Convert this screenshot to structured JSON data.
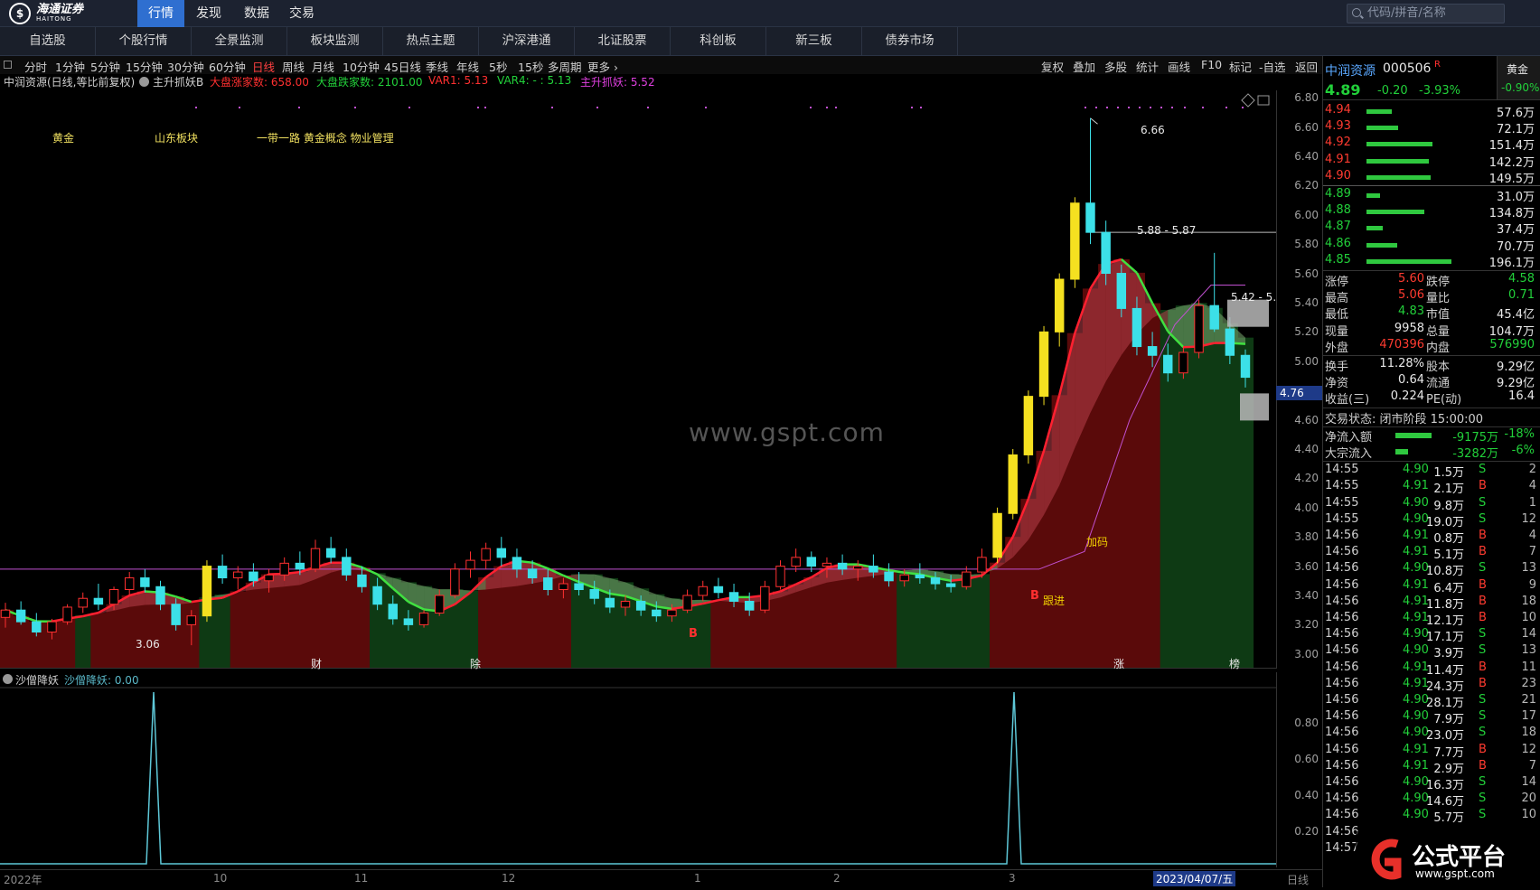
{
  "topbar": {
    "logo_text": "海通证券",
    "logo_sub": "HAITONG",
    "menus": [
      "行情",
      "发现",
      "数据",
      "交易"
    ],
    "search_placeholder": "代码/拼音/名称"
  },
  "nav": [
    "自选股",
    "个股行情",
    "全景监测",
    "板块监测",
    "热点主题",
    "沪深港通",
    "北证股票",
    "科创板",
    "新三板",
    "债券市场"
  ],
  "periods": [
    "分时",
    "1分钟",
    "5分钟",
    "15分钟",
    "30分钟",
    "60分钟",
    "日线",
    "周线",
    "月线",
    "10分钟",
    "45日线",
    "季线",
    "年线",
    "5秒",
    "15秒",
    "多周期",
    "更多 ›"
  ],
  "active_period": "日线",
  "right_tools": [
    "复权",
    "叠加",
    "多股",
    "统计",
    "画线",
    "F10",
    "标记",
    "-自选",
    "返回"
  ],
  "indicator_line": {
    "title": "中润资源(日线,等比前复权)",
    "indicator": "主升抓妖B",
    "items": [
      {
        "text": "大盘涨家数: 658.00",
        "color": "#ff3030"
      },
      {
        "text": "大盘跌家数: 2101.00",
        "color": "#22d03a"
      },
      {
        "text": "VAR1: 5.13",
        "color": "#ff3030"
      },
      {
        "text": "VAR4: - : 5.13",
        "color": "#22d03a"
      },
      {
        "text": "主升抓妖: 5.52",
        "color": "#e040e0"
      }
    ]
  },
  "tags": [
    "黄金",
    "山东板块",
    "一带一路 黄金概念 物业管理"
  ],
  "annotations": {
    "high_label": "6.66",
    "level_line": "5.88 - 5.87",
    "level_line2": "5.42 - 5.",
    "low_label": "3.06",
    "jiama": "加码",
    "genjin": "跟进",
    "B": "B",
    "event_cai": "财",
    "event_chu": "除",
    "event_zhang": "涨",
    "event_bang": "榜"
  },
  "watermark": "www.gspt.com",
  "y_axis": [
    "6.80",
    "6.60",
    "6.40",
    "6.20",
    "6.00",
    "5.80",
    "5.60",
    "5.40",
    "5.20",
    "5.00",
    "4.80",
    "4.60",
    "4.40",
    "4.20",
    "4.00",
    "3.80",
    "3.60",
    "3.40",
    "3.20",
    "3.00"
  ],
  "current_price_tag": "4.76",
  "sub_indicator": {
    "name": "沙僧降妖",
    "value_label": "沙僧降妖: 0.00"
  },
  "sub_y_axis": [
    "0.80",
    "0.60",
    "0.40",
    "0.20"
  ],
  "x_axis": [
    "2022年",
    "10",
    "11",
    "12",
    "1",
    "2",
    "3",
    "2023/04/07/五"
  ],
  "x_period": "日线",
  "quote": {
    "name": "中润资源",
    "code": "000506",
    "badge": "R",
    "price": "4.89",
    "change": "-0.20",
    "pct": "-3.93%",
    "sector": "黄金",
    "sector_pct": "-0.90%",
    "asks": [
      {
        "p": "4.94",
        "v": "57.6万",
        "w": 0.2
      },
      {
        "p": "4.93",
        "v": "72.1万",
        "w": 0.25
      },
      {
        "p": "4.92",
        "v": "151.4万",
        "w": 0.52
      },
      {
        "p": "4.91",
        "v": "142.2万",
        "w": 0.49
      },
      {
        "p": "4.90",
        "v": "149.5万",
        "w": 0.51
      }
    ],
    "bids": [
      {
        "p": "4.89",
        "v": "31.0万",
        "w": 0.11
      },
      {
        "p": "4.88",
        "v": "134.8万",
        "w": 0.46
      },
      {
        "p": "4.87",
        "v": "37.4万",
        "w": 0.13
      },
      {
        "p": "4.86",
        "v": "70.7万",
        "w": 0.24
      },
      {
        "p": "4.85",
        "v": "196.1万",
        "w": 0.67
      }
    ],
    "stats": [
      {
        "l1": "涨停",
        "v1": "5.60",
        "c1": "red",
        "l2": "跌停",
        "v2": "4.58",
        "c2": "green"
      },
      {
        "l1": "最高",
        "v1": "5.06",
        "c1": "red",
        "l2": "量比",
        "v2": "0.71",
        "c2": "green"
      },
      {
        "l1": "最低",
        "v1": "4.83",
        "c1": "green",
        "l2": "市值",
        "v2": "45.4亿",
        "c2": "white"
      },
      {
        "l1": "现量",
        "v1": "9958",
        "c1": "white",
        "l2": "总量",
        "v2": "104.7万",
        "c2": "white"
      },
      {
        "l1": "外盘",
        "v1": "470396",
        "c1": "red",
        "l2": "内盘",
        "v2": "576990",
        "c2": "green"
      }
    ],
    "stats2": [
      {
        "l1": "换手",
        "v1": "11.28%",
        "l2": "股本",
        "v2": "9.29亿"
      },
      {
        "l1": "净资",
        "v1": "0.64",
        "l2": "流通",
        "v2": "9.29亿"
      },
      {
        "l1": "收益(三)",
        "v1": "0.224",
        "l2": "PE(动)",
        "v2": "16.4"
      }
    ],
    "trade_status": "交易状态: 闭市阶段 15:00:00",
    "flows": [
      {
        "label": "净流入额",
        "value": "-9175万",
        "pct": "-18%",
        "w": 40
      },
      {
        "label": "大宗流入",
        "value": "-3282万",
        "pct": "-6%",
        "w": 14
      }
    ],
    "ticks": [
      {
        "t": "14:55",
        "p": "4.90",
        "v": "1.5万",
        "d": "S",
        "n": "2"
      },
      {
        "t": "14:55",
        "p": "4.91",
        "v": "2.1万",
        "d": "B",
        "n": "4"
      },
      {
        "t": "14:55",
        "p": "4.90",
        "v": "9.8万",
        "d": "S",
        "n": "1"
      },
      {
        "t": "14:55",
        "p": "4.90",
        "v": "19.0万",
        "d": "S",
        "n": "12"
      },
      {
        "t": "14:56",
        "p": "4.91",
        "v": "0.8万",
        "d": "B",
        "n": "4"
      },
      {
        "t": "14:56",
        "p": "4.91",
        "v": "5.1万",
        "d": "B",
        "n": "7"
      },
      {
        "t": "14:56",
        "p": "4.90",
        "v": "10.8万",
        "d": "S",
        "n": "13"
      },
      {
        "t": "14:56",
        "p": "4.91",
        "v": "6.4万",
        "d": "B",
        "n": "9"
      },
      {
        "t": "14:56",
        "p": "4.91",
        "v": "11.8万",
        "d": "B",
        "n": "18"
      },
      {
        "t": "14:56",
        "p": "4.91",
        "v": "12.1万",
        "d": "B",
        "n": "10"
      },
      {
        "t": "14:56",
        "p": "4.90",
        "v": "17.1万",
        "d": "S",
        "n": "14"
      },
      {
        "t": "14:56",
        "p": "4.90",
        "v": "3.9万",
        "d": "S",
        "n": "13"
      },
      {
        "t": "14:56",
        "p": "4.91",
        "v": "11.4万",
        "d": "B",
        "n": "11"
      },
      {
        "t": "14:56",
        "p": "4.91",
        "v": "24.3万",
        "d": "B",
        "n": "23"
      },
      {
        "t": "14:56",
        "p": "4.90",
        "v": "28.1万",
        "d": "S",
        "n": "21"
      },
      {
        "t": "14:56",
        "p": "4.90",
        "v": "7.9万",
        "d": "S",
        "n": "17"
      },
      {
        "t": "14:56",
        "p": "4.90",
        "v": "23.0万",
        "d": "S",
        "n": "18"
      },
      {
        "t": "14:56",
        "p": "4.91",
        "v": "7.7万",
        "d": "B",
        "n": "12"
      },
      {
        "t": "14:56",
        "p": "4.91",
        "v": "2.9万",
        "d": "B",
        "n": "7"
      },
      {
        "t": "14:56",
        "p": "4.90",
        "v": "16.3万",
        "d": "S",
        "n": "14"
      },
      {
        "t": "14:56",
        "p": "4.90",
        "v": "14.6万",
        "d": "S",
        "n": "20"
      },
      {
        "t": "14:56",
        "p": "4.90",
        "v": "5.7万",
        "d": "S",
        "n": "10"
      },
      {
        "t": "14:56",
        "p": "",
        "v": "",
        "d": "",
        "n": ""
      },
      {
        "t": "14:57",
        "p": "",
        "v": "",
        "d": "",
        "n": ""
      }
    ]
  },
  "brand": {
    "name": "公式平台",
    "url": "www.gspt.com"
  },
  "chart_data": {
    "type": "candlestick",
    "y_range": [
      2.9,
      6.85
    ],
    "candles": [
      [
        3.25,
        3.35,
        3.18,
        3.3
      ],
      [
        3.3,
        3.36,
        3.2,
        3.22
      ],
      [
        3.22,
        3.28,
        3.12,
        3.15
      ],
      [
        3.15,
        3.24,
        3.1,
        3.22
      ],
      [
        3.22,
        3.34,
        3.2,
        3.32
      ],
      [
        3.32,
        3.42,
        3.28,
        3.38
      ],
      [
        3.38,
        3.48,
        3.3,
        3.34
      ],
      [
        3.34,
        3.46,
        3.3,
        3.44
      ],
      [
        3.44,
        3.56,
        3.4,
        3.52
      ],
      [
        3.52,
        3.58,
        3.42,
        3.46
      ],
      [
        3.46,
        3.5,
        3.3,
        3.34
      ],
      [
        3.34,
        3.38,
        3.16,
        3.2
      ],
      [
        3.2,
        3.3,
        3.06,
        3.26
      ],
      [
        3.26,
        3.64,
        3.22,
        3.6
      ],
      [
        3.6,
        3.68,
        3.48,
        3.52
      ],
      [
        3.52,
        3.6,
        3.44,
        3.56
      ],
      [
        3.56,
        3.62,
        3.46,
        3.5
      ],
      [
        3.5,
        3.58,
        3.42,
        3.54
      ],
      [
        3.54,
        3.66,
        3.5,
        3.62
      ],
      [
        3.62,
        3.7,
        3.54,
        3.58
      ],
      [
        3.58,
        3.78,
        3.56,
        3.72
      ],
      [
        3.72,
        3.8,
        3.62,
        3.66
      ],
      [
        3.66,
        3.72,
        3.5,
        3.54
      ],
      [
        3.54,
        3.6,
        3.42,
        3.46
      ],
      [
        3.46,
        3.52,
        3.3,
        3.34
      ],
      [
        3.34,
        3.4,
        3.2,
        3.24
      ],
      [
        3.24,
        3.3,
        3.16,
        3.2
      ],
      [
        3.2,
        3.3,
        3.18,
        3.28
      ],
      [
        3.28,
        3.44,
        3.26,
        3.4
      ],
      [
        3.4,
        3.62,
        3.38,
        3.58
      ],
      [
        3.58,
        3.7,
        3.52,
        3.64
      ],
      [
        3.64,
        3.76,
        3.58,
        3.72
      ],
      [
        3.72,
        3.8,
        3.6,
        3.66
      ],
      [
        3.66,
        3.72,
        3.52,
        3.58
      ],
      [
        3.58,
        3.64,
        3.48,
        3.52
      ],
      [
        3.52,
        3.58,
        3.4,
        3.44
      ],
      [
        3.44,
        3.52,
        3.38,
        3.48
      ],
      [
        3.48,
        3.56,
        3.4,
        3.44
      ],
      [
        3.44,
        3.5,
        3.34,
        3.38
      ],
      [
        3.38,
        3.44,
        3.28,
        3.32
      ],
      [
        3.32,
        3.4,
        3.26,
        3.36
      ],
      [
        3.36,
        3.4,
        3.26,
        3.3
      ],
      [
        3.3,
        3.36,
        3.22,
        3.26
      ],
      [
        3.26,
        3.34,
        3.22,
        3.3
      ],
      [
        3.3,
        3.44,
        3.28,
        3.4
      ],
      [
        3.4,
        3.5,
        3.36,
        3.46
      ],
      [
        3.46,
        3.52,
        3.38,
        3.42
      ],
      [
        3.42,
        3.48,
        3.32,
        3.36
      ],
      [
        3.36,
        3.42,
        3.26,
        3.3
      ],
      [
        3.3,
        3.5,
        3.28,
        3.46
      ],
      [
        3.46,
        3.64,
        3.44,
        3.6
      ],
      [
        3.6,
        3.72,
        3.56,
        3.66
      ],
      [
        3.66,
        3.7,
        3.56,
        3.6
      ],
      [
        3.6,
        3.66,
        3.52,
        3.62
      ],
      [
        3.62,
        3.68,
        3.54,
        3.58
      ],
      [
        3.58,
        3.64,
        3.5,
        3.6
      ],
      [
        3.6,
        3.68,
        3.52,
        3.56
      ],
      [
        3.56,
        3.62,
        3.46,
        3.5
      ],
      [
        3.5,
        3.58,
        3.46,
        3.54
      ],
      [
        3.54,
        3.62,
        3.48,
        3.52
      ],
      [
        3.52,
        3.56,
        3.44,
        3.48
      ],
      [
        3.48,
        3.54,
        3.42,
        3.46
      ],
      [
        3.46,
        3.6,
        3.44,
        3.56
      ],
      [
        3.56,
        3.72,
        3.52,
        3.66
      ],
      [
        3.66,
        4.0,
        3.62,
        3.96
      ],
      [
        3.96,
        4.4,
        3.92,
        4.36
      ],
      [
        4.36,
        4.8,
        4.3,
        4.76
      ],
      [
        4.76,
        5.24,
        4.7,
        5.2
      ],
      [
        5.2,
        5.6,
        5.1,
        5.56
      ],
      [
        5.56,
        6.12,
        5.5,
        6.08
      ],
      [
        6.08,
        6.66,
        5.8,
        5.88
      ],
      [
        5.88,
        5.96,
        5.52,
        5.6
      ],
      [
        5.6,
        5.66,
        5.3,
        5.36
      ],
      [
        5.36,
        5.44,
        5.04,
        5.1
      ],
      [
        5.1,
        5.2,
        4.96,
        5.04
      ],
      [
        5.04,
        5.12,
        4.86,
        4.92
      ],
      [
        4.92,
        5.1,
        4.88,
        5.06
      ],
      [
        5.06,
        5.42,
        5.02,
        5.38
      ],
      [
        5.38,
        5.74,
        5.2,
        5.22
      ],
      [
        5.22,
        5.3,
        4.98,
        5.04
      ],
      [
        5.04,
        5.08,
        4.82,
        4.89
      ]
    ],
    "spikes": [
      0.1,
      0.78
    ]
  }
}
